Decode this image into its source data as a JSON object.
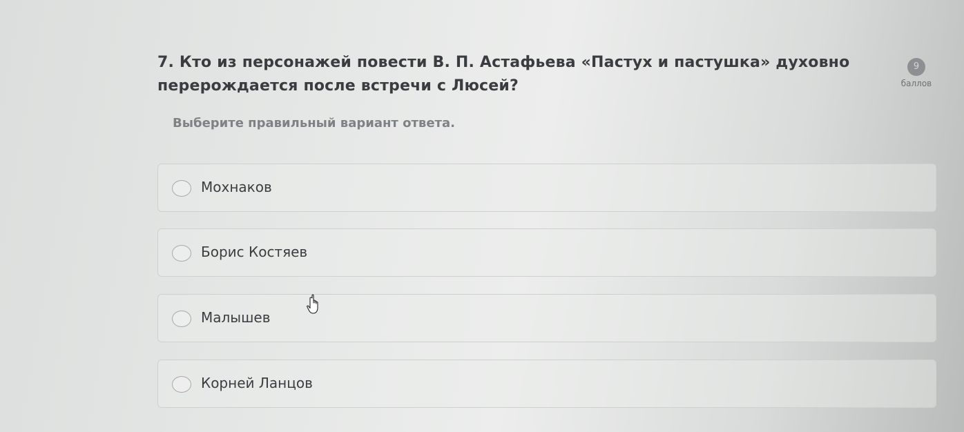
{
  "question": {
    "text": "7. Кто из персонажей повести В. П. Астафьева «Пастух и пастушка» духовно перерождается после встречи с Люсей?",
    "points_value": "9",
    "points_label": "баллов"
  },
  "instruction": "Выберите правильный вариант ответа.",
  "options": [
    {
      "label": "Мохнаков",
      "selected": false
    },
    {
      "label": "Борис Костяев",
      "selected": false
    },
    {
      "label": "Малышев",
      "selected": false
    },
    {
      "label": "Корней Ланцов",
      "selected": false
    }
  ],
  "cursor_icon": "hand-pointer-icon"
}
